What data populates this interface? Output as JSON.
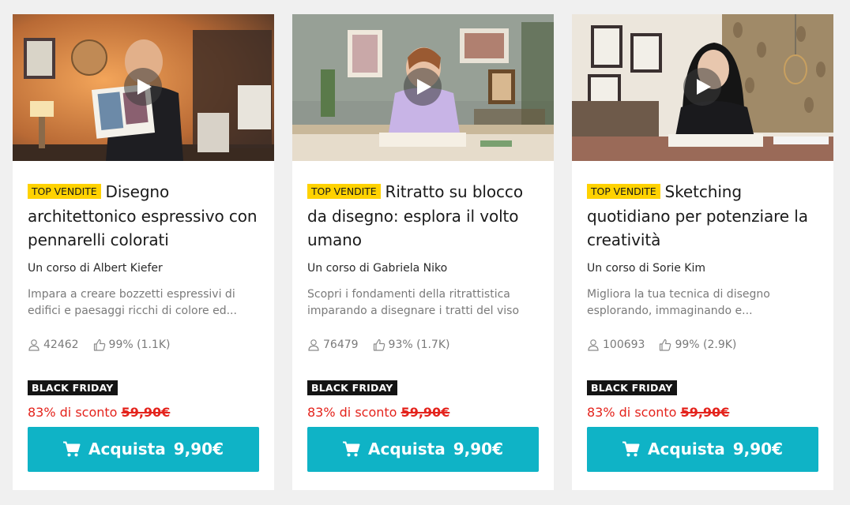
{
  "courses": [
    {
      "badge": "TOP VENDITE",
      "title": "Disegno architettonico espressivo con pennarelli colorati",
      "author": "Un corso di Albert Kiefer",
      "description": "Impara a creare bozzetti espressivi di edifici e paesaggi ricchi di colore ed...",
      "students": "42462",
      "rating": "99% (1.1K)",
      "promo": "BLACK FRIDAY",
      "discount": "83% di sconto",
      "old_price": "59,90€",
      "buy_label": "Acquista",
      "price": "9,90€"
    },
    {
      "badge": "TOP VENDITE",
      "title": "Ritratto su blocco da disegno: esplora il volto umano",
      "author": "Un corso di Gabriela Niko",
      "description": "Scopri i fondamenti della ritrattistica imparando a disegnare i tratti del viso e...",
      "students": "76479",
      "rating": "93% (1.7K)",
      "promo": "BLACK FRIDAY",
      "discount": "83% di sconto",
      "old_price": "59,90€",
      "buy_label": "Acquista",
      "price": "9,90€"
    },
    {
      "badge": "TOP VENDITE",
      "title": "Sketching quotidiano per potenziare la creatività",
      "author": "Un corso di Sorie Kim",
      "description": "Migliora la tua tecnica di disegno esplorando, immaginando e...",
      "students": "100693",
      "rating": "99% (2.9K)",
      "promo": "BLACK FRIDAY",
      "discount": "83% di sconto",
      "old_price": "59,90€",
      "buy_label": "Acquista",
      "price": "9,90€"
    }
  ],
  "colors": {
    "top_badge": "#ffd200",
    "promo_badge": "#141414",
    "discount_text": "#e4231c",
    "buy_button": "#0fb3c6"
  },
  "icons": [
    "play-icon",
    "user-icon",
    "thumbs-up-icon",
    "cart-icon"
  ]
}
